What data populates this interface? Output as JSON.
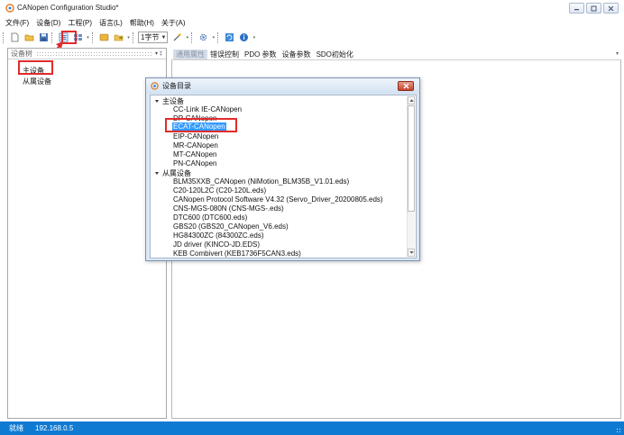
{
  "window": {
    "title": "CANopen Configuration Studio*",
    "controls": [
      "minimize",
      "maximize",
      "close"
    ]
  },
  "menu": {
    "items": [
      "文件(F)",
      "设备(D)",
      "工程(P)",
      "语言(L)",
      "帮助(H)",
      "关于(A)"
    ]
  },
  "toolbar": {
    "bytes_value": "1字节",
    "icons": [
      "new-file-icon",
      "open-folder-icon",
      "save-icon",
      "device-catalog-icon",
      "device-list-icon",
      "tool-icon",
      "export-icon",
      "wand-icon",
      "settings-icon",
      "refresh-icon",
      "info-icon"
    ]
  },
  "left_panel": {
    "title": "设备树",
    "pin": "▾ ‡",
    "tree": {
      "master": "主设备",
      "slave": "从属设备"
    }
  },
  "tabs": [
    "通用属性",
    "错误控制",
    "PDO 参数",
    "设备参数",
    "SDO初始化"
  ],
  "active_tab_index": 0,
  "dialog": {
    "title": "设备目录",
    "groups": [
      {
        "label": "主设备",
        "items": [
          "CC-Link IE-CANopen",
          "DP-CANopen",
          "ECAT-CANopen",
          "EIP-CANopen",
          "MR-CANopen",
          "MT-CANopen",
          "PN-CANopen"
        ]
      },
      {
        "label": "从属设备",
        "items": [
          "BLM35XXB_CANopen (NiMotion_BLM35B_V1.01.eds)",
          "C20-120L2C (C20-120L.eds)",
          "CANopen Protocol Software V4.32 (Servo_Driver_20200805.eds)",
          "CNS-MGS-080N (CNS-MGS-.eds)",
          "DTC600 (DTC600.eds)",
          "GBS20 (GBS20_CANopen_V6.eds)",
          "HG84300ZC (84300ZC.eds)",
          "JD driver (KINCO-JD.EDS)",
          "KEB Combivert (KEB1736F5CAN3.eds)"
        ]
      }
    ],
    "selected_item": "ECAT-CANopen"
  },
  "status": {
    "state": "就绪",
    "ip": "192.168.0.5"
  },
  "colors": {
    "status_bar": "#0f7ad2",
    "highlight_box": "#e12b2b",
    "selection": "#3399ff",
    "dialog_frame": "#dbe7f4"
  }
}
